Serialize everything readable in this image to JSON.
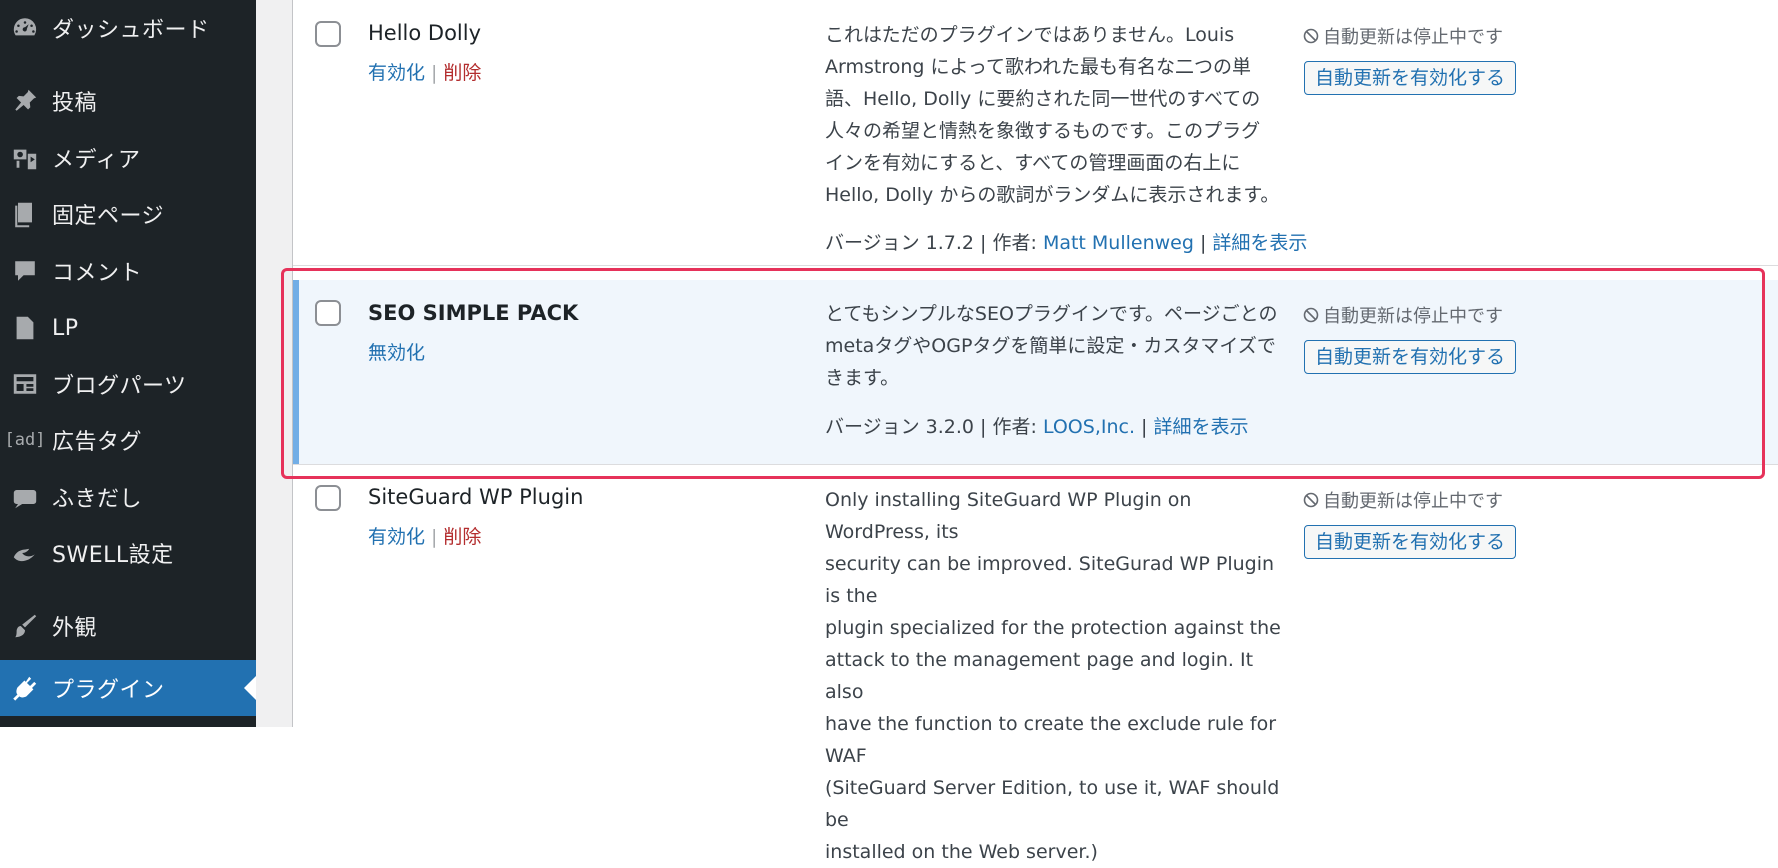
{
  "sidebar": {
    "items": [
      {
        "label": "ダッシュボード",
        "icon": "dashboard-icon"
      },
      {
        "label": "投稿",
        "icon": "pin-icon"
      },
      {
        "label": "メディア",
        "icon": "media-icon"
      },
      {
        "label": "固定ページ",
        "icon": "page-icon"
      },
      {
        "label": "コメント",
        "icon": "comment-icon"
      },
      {
        "label": "LP",
        "icon": "document-icon"
      },
      {
        "label": "ブログパーツ",
        "icon": "layout-icon"
      },
      {
        "label": "広告タグ",
        "icon": "ad-icon",
        "icon_text": "[ad]"
      },
      {
        "label": "ふきだし",
        "icon": "speech-bubble-icon"
      },
      {
        "label": "SWELL設定",
        "icon": "swell-icon"
      },
      {
        "label": "外観",
        "icon": "brush-icon"
      },
      {
        "label": "プラグイン",
        "icon": "plugin-icon",
        "active": true
      }
    ]
  },
  "plugins": [
    {
      "name": "Hello Dolly",
      "actions": {
        "activate": "有効化",
        "delete": "削除"
      },
      "description_lines": [
        "これはただのプラグインではありません。Louis",
        "Armstrong によって歌われた最も有名な二つの単",
        "語、Hello, Dolly に要約された同一世代のすべての",
        "人々の希望と情熱を象徴するものです。このプラグ",
        "インを有効にすると、すべての管理画面の右上に",
        "Hello, Dolly からの歌詞がランダムに表示されます。"
      ],
      "version_text": "バージョン 1.7.2 | 作者: ",
      "author": "Matt Mullenweg",
      "details_sep": " | ",
      "details": "詳細を表示",
      "auto_update_status": "自動更新は停止中です",
      "auto_update_button": "自動更新を有効化する"
    },
    {
      "name": "SEO SIMPLE PACK",
      "actions": {
        "deactivate": "無効化"
      },
      "description_lines": [
        "とてもシンプルなSEOプラグインです。ページごとの",
        "metaタグやOGPタグを簡単に設定・カスタマイズで",
        "きます。"
      ],
      "version_text": "バージョン 3.2.0 | 作者: ",
      "author": "LOOS,Inc.",
      "details_sep": " | ",
      "details": "詳細を表示",
      "auto_update_status": "自動更新は停止中です",
      "auto_update_button": "自動更新を有効化する",
      "active": true
    },
    {
      "name": "SiteGuard WP Plugin",
      "actions": {
        "activate": "有効化",
        "delete": "削除"
      },
      "description_lines": [
        "Only installing SiteGuard WP Plugin on WordPress, its",
        "security can be improved. SiteGurad WP Plugin is the",
        "plugin specialized for the protection against the",
        "attack to the management page and login. It also",
        "have the function to create the exclude rule for WAF",
        "(SiteGuard Server Edition, to use it, WAF should be",
        "installed on the Web server.)"
      ],
      "auto_update_status": "自動更新は停止中です",
      "auto_update_button": "自動更新を有効化する"
    }
  ],
  "colors": {
    "sidebar_bg": "#1d2327",
    "active_menu": "#2271b1",
    "link": "#2271b1",
    "delete": "#b32d2e",
    "active_row_bg": "#f0f6fc",
    "active_row_bar": "#72aee6",
    "highlight": "#e6325a"
  }
}
